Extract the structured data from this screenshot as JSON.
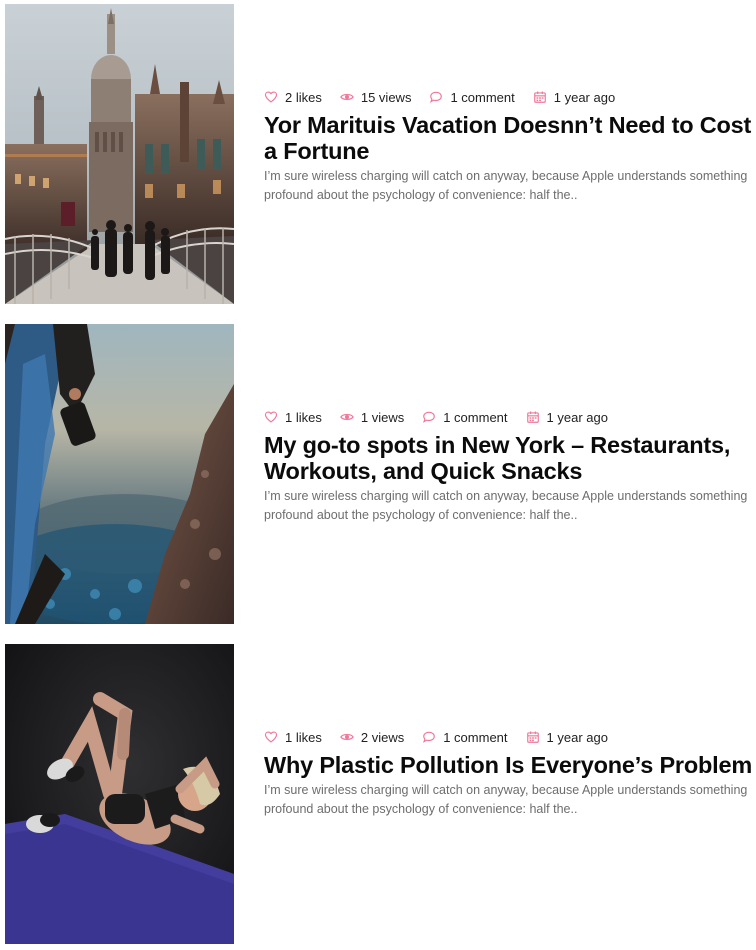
{
  "colors": {
    "accent": "#f1789a",
    "title": "#0b0b0b",
    "excerpt": "#6d6d6d"
  },
  "icons": {
    "likes": "heart-icon",
    "views": "eye-icon",
    "comments": "comment-bubble-icon",
    "date": "calendar-icon"
  },
  "posts": [
    {
      "image": "london-bridge-cathedral-photo",
      "likes": "2 likes",
      "views": "15 views",
      "comments": "1 comment",
      "date": "1 year ago",
      "title": "Yor Marituis Vacation Doesnn’t Need to Cost a Fortune",
      "excerpt": "I’m sure wireless charging will catch on anyway, because Apple understands something profound about the psychology of convenience: half the.."
    },
    {
      "image": "hiker-cliff-photo",
      "likes": "1 likes",
      "views": "1 views",
      "comments": "1 comment",
      "date": "1 year ago",
      "title": "My go-to spots in New York – Restaurants, Workouts, and Quick Snacks",
      "excerpt": "I’m sure wireless charging will catch on anyway, because Apple understands something profound about the psychology of convenience: half the.."
    },
    {
      "image": "woman-workout-mat-photo",
      "likes": "1 likes",
      "views": "2 views",
      "comments": "1 comment",
      "date": "1 year ago",
      "title": "Why Plastic Pollution Is Everyone’s Problem",
      "excerpt": "I’m sure wireless charging will catch on anyway, because Apple understands something profound about the psychology of convenience: half the.."
    }
  ]
}
